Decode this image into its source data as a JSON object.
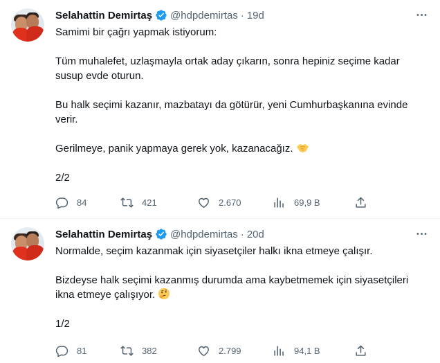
{
  "tweets": [
    {
      "author": "Selahattin Demirtaş",
      "handle": "@hdpdemirtas",
      "separator": "·",
      "time": "19d",
      "paragraphs": [
        "Samimi bir çağrı yapmak istiyorum:",
        "Tüm muhalefet, uzlaşmayla ortak aday çıkarın, sonra hepiniz seçime kadar susup evde oturun.",
        "Bu halk seçimi kazanır, mazbatayı da götürür, yeni Cumhurbaşkanına evinde verir.",
        "Gerilmeye, panik yapmaya gerek yok, kazanacağız.",
        "2/2"
      ],
      "emoji": "handshake-emoji",
      "replies": "84",
      "retweets": "421",
      "likes": "2.670",
      "views": "69,9 B"
    },
    {
      "author": "Selahattin Demirtaş",
      "handle": "@hdpdemirtas",
      "separator": "·",
      "time": "20d",
      "paragraphs": [
        "Normalde, seçim kazanmak için siyasetçiler halkı ikna etmeye çalışır.",
        "Bizdeyse halk seçimi kazanmış durumda ama kaybetmemek için siyasetçileri ikna etmeye çalışıyor.",
        "1/2"
      ],
      "emoji": "thinking-face-emoji",
      "replies": "81",
      "retweets": "382",
      "likes": "2.799",
      "views": "94,1 B"
    }
  ],
  "colors": {
    "text": "#0f1419",
    "secondary": "#536471",
    "verified": "#1d9bf0",
    "divider": "#eff3f4"
  }
}
